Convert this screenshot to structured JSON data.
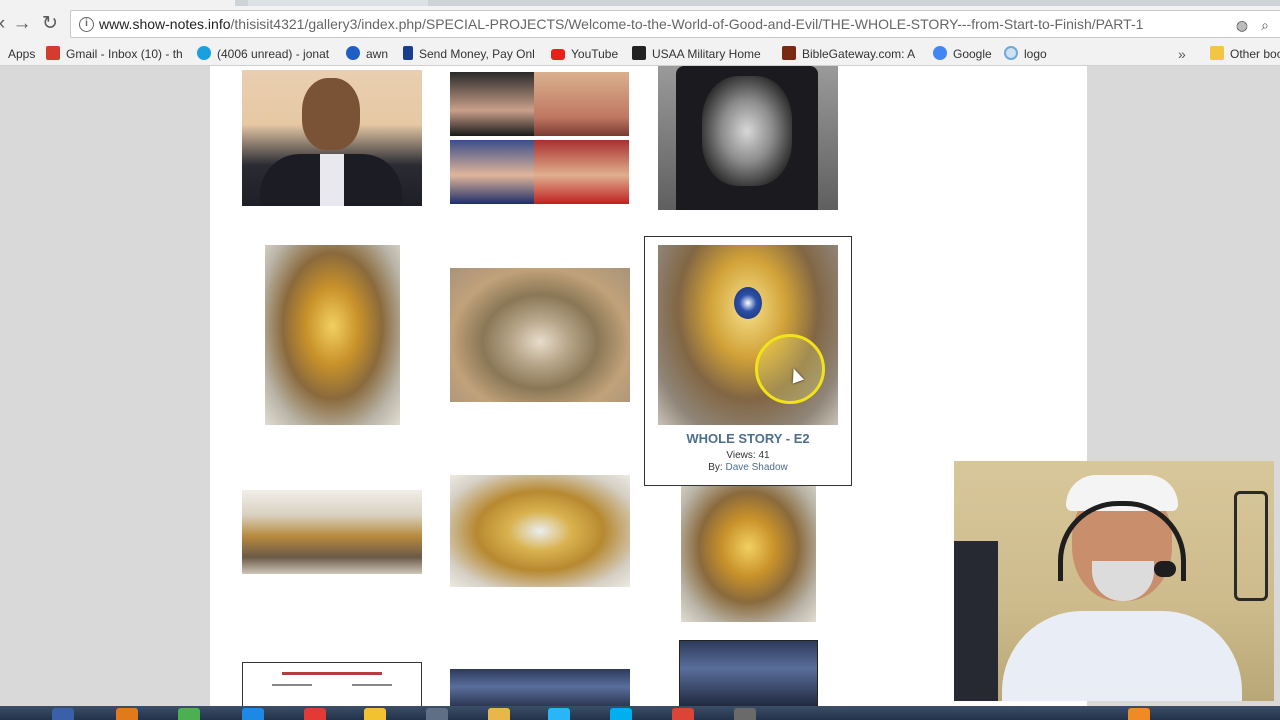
{
  "browser": {
    "url_host": "www.show-notes.info",
    "url_path": "/thisisit4321/gallery3/index.php/SPECIAL-PROJECTS/Welcome-to-the-World-of-Good-and-Evil/THE-WHOLE-STORY---from-Start-to-Finish/PART-1",
    "nav": {
      "forward_glyph": "→",
      "reload_glyph": "↻",
      "back_glyph": "‹"
    },
    "info_glyph": "i",
    "search_glyph": "⌕",
    "translate_glyph": "◍"
  },
  "bookmarks": {
    "items": [
      {
        "label": "Apps",
        "icon": "apps-grid-icon",
        "color": "#4a76c9"
      },
      {
        "label": "Gmail - Inbox (10) - th",
        "icon": "gmail-icon",
        "color": "#d33c2f"
      },
      {
        "label": "(4006 unread) - jonat",
        "icon": "att-icon",
        "color": "#18a0e0"
      },
      {
        "label": "awn",
        "icon": "awn-icon",
        "color": "#1f5fc4"
      },
      {
        "label": "Send Money, Pay Onl",
        "icon": "paypal-icon",
        "color": "#1a3d8f"
      },
      {
        "label": "YouTube",
        "icon": "youtube-icon",
        "color": "#e62117"
      },
      {
        "label": "USAA Military Home",
        "icon": "usaa-icon",
        "color": "#222222"
      },
      {
        "label": "BibleGateway.com: A",
        "icon": "biblegateway-icon",
        "color": "#7a2a10"
      },
      {
        "label": "Google",
        "icon": "google-icon",
        "color": "#4285f4"
      },
      {
        "label": "logo",
        "icon": "logo-icon",
        "color": "#6fa8dc"
      }
    ],
    "more_glyph": "»",
    "other": "Other boo"
  },
  "gallery": {
    "featured": {
      "title": "WHOLE STORY - E2",
      "views": "Views: 41",
      "by_prefix": "By: ",
      "author": "Dave Shadow"
    }
  },
  "colors": {
    "link": "#4e6e8e",
    "highlight_ring": "#f2e21a",
    "page_bg": "#ffffff",
    "outer_bg": "#d9d9d9"
  }
}
